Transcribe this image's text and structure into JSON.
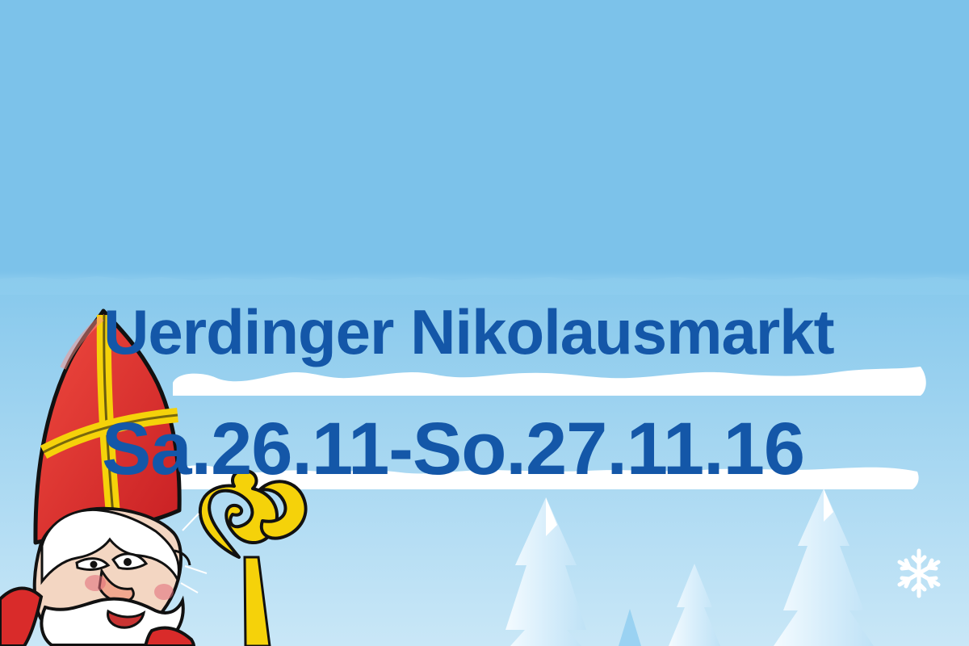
{
  "poster": {
    "title": "Uerdinger Nikolausmarkt",
    "date": "Sa.26.11-So.27.11.16"
  },
  "colors": {
    "sky": "#7ec3ea",
    "text": "#1457a8",
    "snow": "#ffffff",
    "mitre_red": "#d92b2a",
    "gold": "#f5d20a"
  },
  "icons": {
    "snowflake": "snowflake-icon",
    "tree": "fir-tree-icon",
    "character": "saint-nicholas-illustration"
  }
}
